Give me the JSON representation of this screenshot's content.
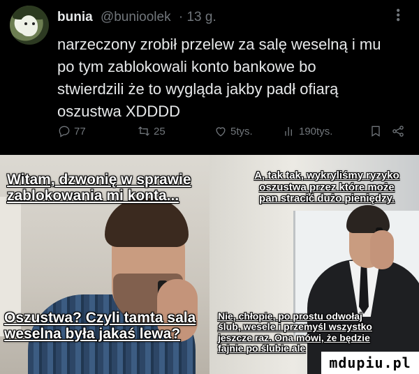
{
  "tweet": {
    "author_name": "bunia",
    "author_handle": "@bunioolek",
    "time": "· 13 g.",
    "lines": [
      "narzeczony zrobił przelew za salę weselną i mu",
      "po tym zablokowali konto bankowe bo",
      "stwierdzili że to wygląda jakby padł ofiarą",
      "oszustwa XDDDD"
    ],
    "actions": {
      "reply_count": "77",
      "retweet_count": "25",
      "like_count": "5tys.",
      "views_count": "190tys."
    },
    "icons": [
      "reply-icon",
      "retweet-icon",
      "like-icon",
      "views-icon",
      "bookmark-icon",
      "share-icon",
      "more-icon"
    ]
  },
  "meme": {
    "left_top": [
      "Witam, dzwonię w sprawie",
      "zablokowania mi konta..."
    ],
    "left_bottom": [
      "Oszustwa? Czyli tamta sala",
      "weselna była jakaś lewa?"
    ],
    "right_top": [
      "A, tak tak, wykryliśmy ryzyko",
      "oszustwa przez które może",
      "pan stracić dużo pieniędzy."
    ],
    "right_bottom": [
      "Nie, chłopie, po prostu odwołaj",
      "ślub, wesele i przemyśl wszystko",
      "jeszcze raz. Ona mówi, że będzie",
      "fajnie po ślubie ale"
    ],
    "watermark": "mdupiu.pl"
  }
}
